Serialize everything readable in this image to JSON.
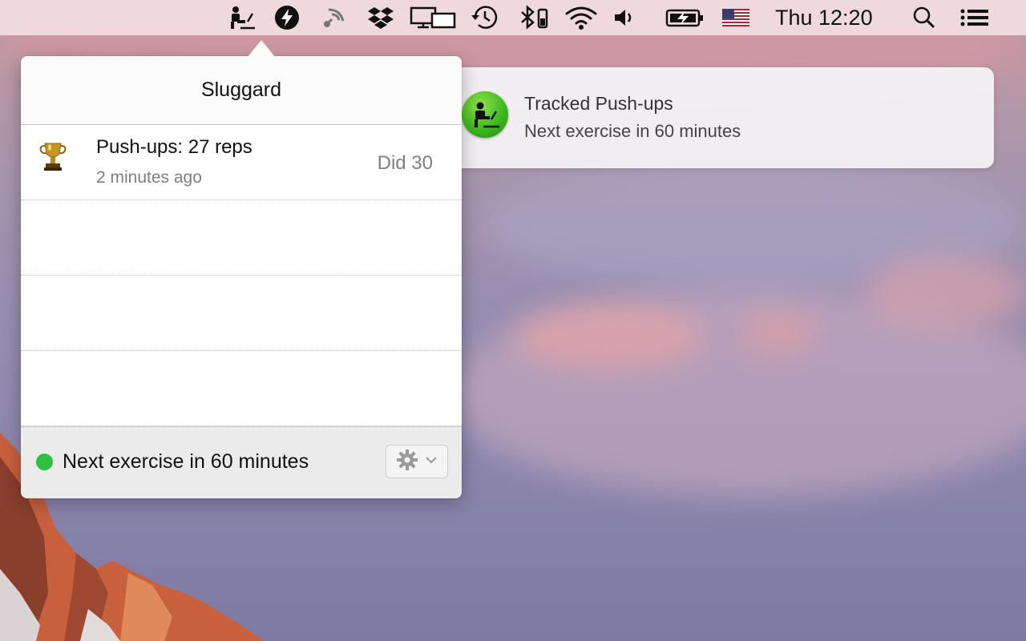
{
  "menubar": {
    "clock": "Thu 12:20",
    "icons": [
      "sluggard-desk-icon",
      "bolt-icon",
      "satellite-icon",
      "dropbox-icon",
      "displays-icon",
      "time-machine-icon",
      "bluetooth-icon",
      "wifi-icon",
      "volume-icon",
      "battery-charging-icon",
      "us-flag-icon",
      "search-icon",
      "list-icon"
    ]
  },
  "popover": {
    "title": "Sluggard",
    "entries": [
      {
        "icon": "trophy-icon",
        "title": "Push-ups: 27 reps",
        "subtitle": "2 minutes ago",
        "detail": "Did 30"
      }
    ],
    "footer": {
      "status_text": "Next exercise in 60 minutes",
      "status_color": "#2dc13f",
      "settings_icon": "gear-icon"
    }
  },
  "notification": {
    "title": "Tracked Push-ups",
    "body": "Next exercise in 60 minutes",
    "icon": "sluggard-app-icon",
    "icon_color": "#38b51c"
  }
}
